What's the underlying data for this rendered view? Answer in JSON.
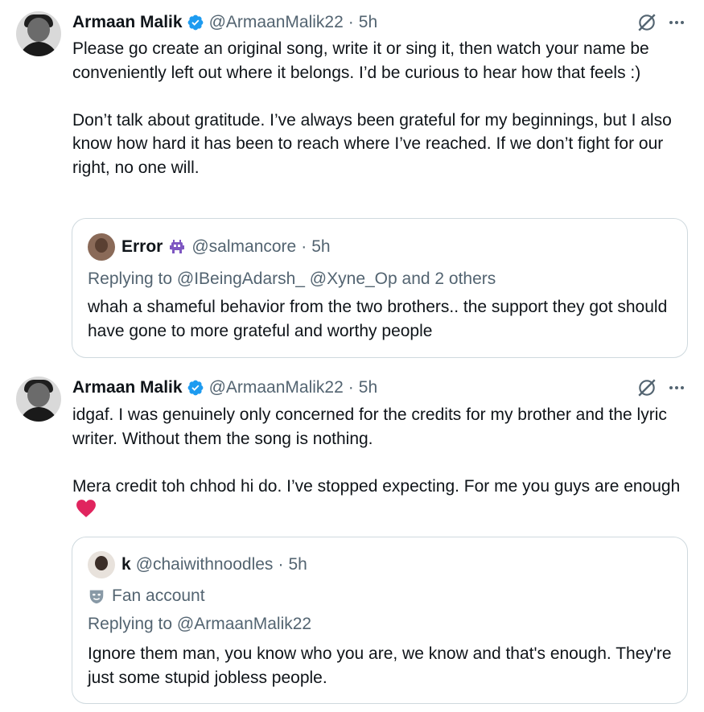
{
  "tweets": [
    {
      "author": {
        "name": "Armaan Malik",
        "handle": "@ArmaanMalik22",
        "time": "5h"
      },
      "text": "Please go create an original song, write it or sing it, then watch your name be conveniently left out where it belongs. I’d be curious to hear how that feels :)\n\nDon’t talk about gratitude. I’ve always been grateful for my beginnings, but I also know how hard it has been to reach where I’ve reached. If we don’t fight for our right, no one will.",
      "quote": {
        "name": "Error",
        "handle": "@salmancore",
        "time": "5h",
        "emoji_icon": "alien-monster-icon",
        "replying": "Replying to @IBeingAdarsh_ @Xyne_Op and 2 others",
        "text": "whah a shameful behavior from the two brothers.. the support they got should have gone to more grateful and worthy people"
      }
    },
    {
      "author": {
        "name": "Armaan Malik",
        "handle": "@ArmaanMalik22",
        "time": "5h"
      },
      "text": "idgaf. I was genuinely only concerned for the credits for my brother and the lyric writer. Without them the song is nothing.\n\nMera credit toh chhod hi do. I’ve stopped expecting. For me you guys are enough",
      "text_emoji": "red-heart-icon",
      "quote": {
        "name": "k",
        "handle": "@chaiwithnoodles",
        "time": "5h",
        "label_icon": "mask-icon",
        "label": "Fan account",
        "replying": "Replying to @ArmaanMalik22",
        "text": "Ignore them man, you know who you are, we know and that's enough. They're just some stupid jobless people."
      }
    }
  ],
  "colors": {
    "verified": "#1d9bf0",
    "secondary_text": "#536471",
    "border": "#cfd9de",
    "heart": "#e0245e"
  },
  "separator": "·"
}
